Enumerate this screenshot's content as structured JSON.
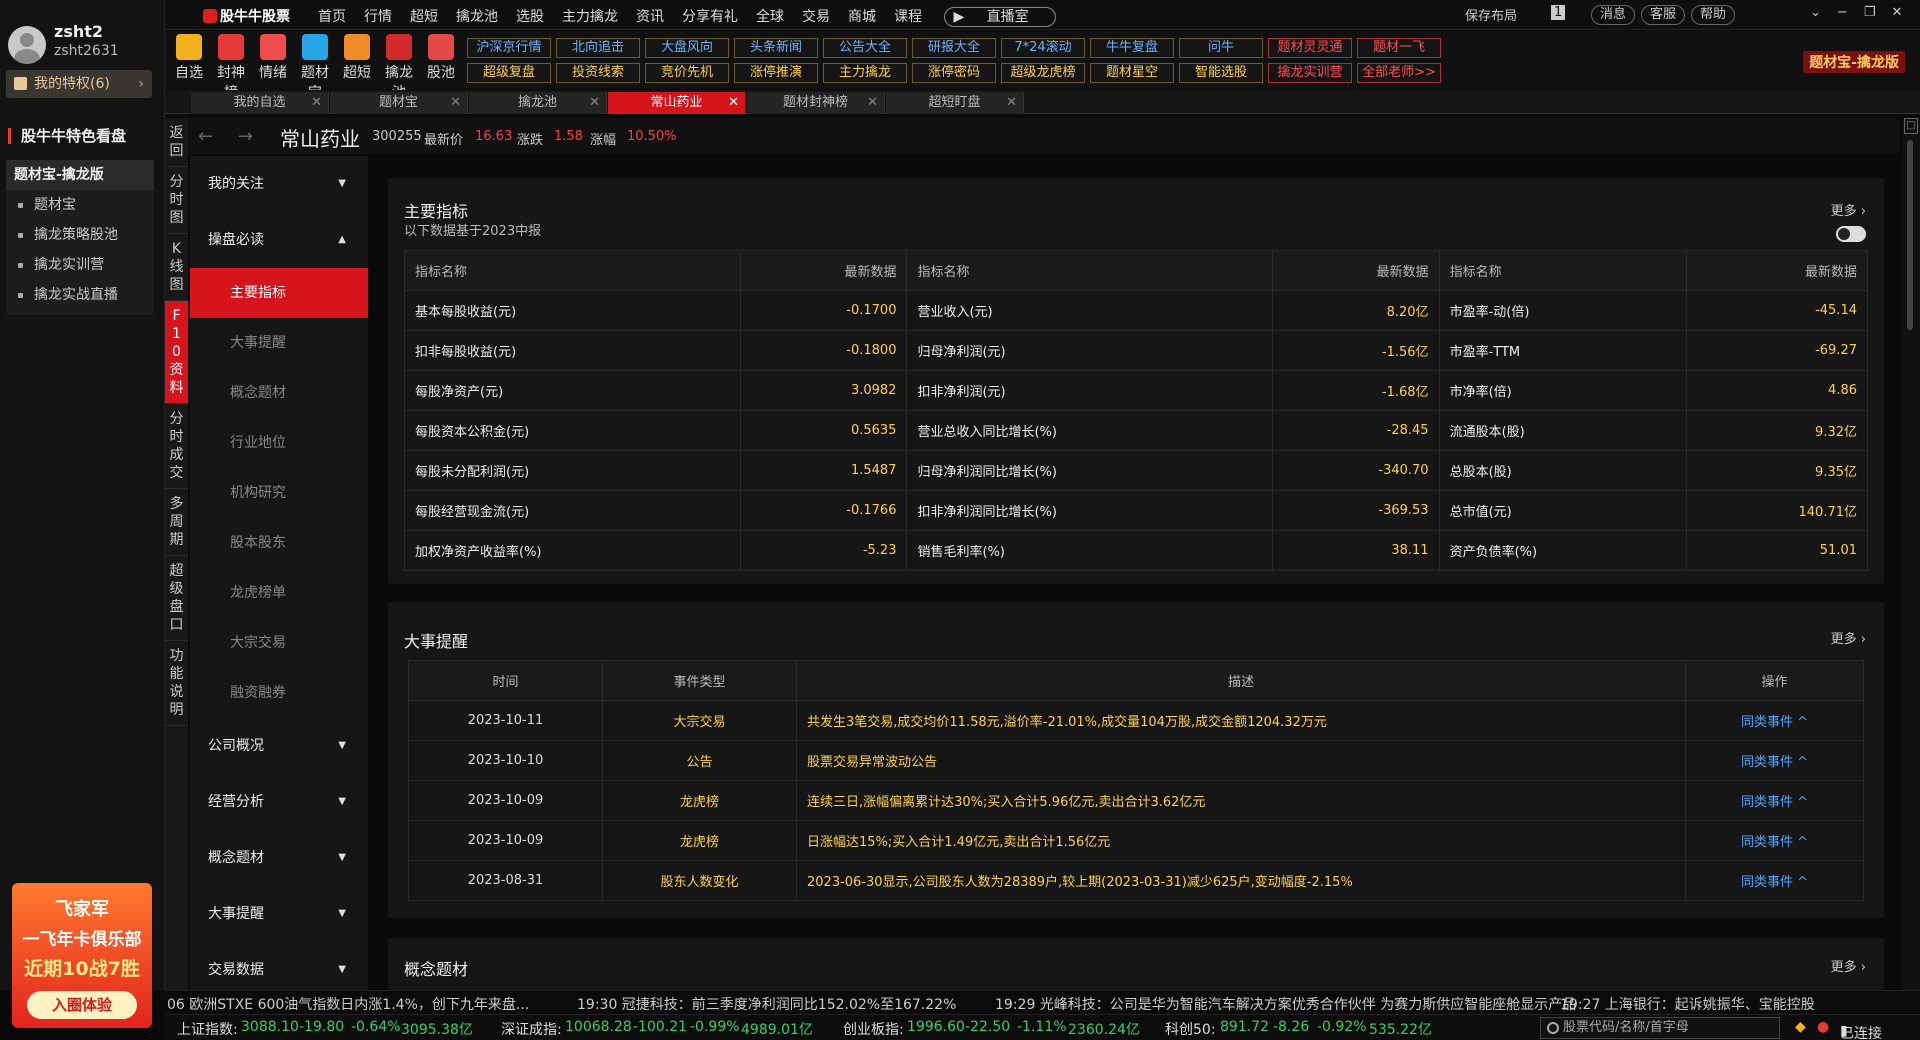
{
  "user": {
    "name": "zsht2",
    "id": "zsht2631",
    "privilege": "我的特权(6)"
  },
  "sidebar": {
    "feature_title": "股牛牛特色看盘",
    "group": "题材宝-擒龙版",
    "items": [
      "题材宝",
      "擒龙策略股池",
      "擒龙实训营",
      "擒龙实战直播"
    ]
  },
  "ad": {
    "l1": "飞家军",
    "l2": "一飞年卡俱乐部",
    "l3": "近期10战7胜",
    "btn": "入圈体验"
  },
  "vnav": [
    "返回",
    "分时图",
    "K线图",
    "F10资料",
    "分时成交",
    "多周期",
    "超级盘口",
    "功能说明"
  ],
  "topbar": {
    "logo": "股牛牛股票",
    "menu": [
      "首页",
      "行情",
      "超短",
      "擒龙池",
      "选股",
      "主力擒龙",
      "资讯",
      "分享有礼",
      "全球",
      "交易",
      "商城",
      "课程"
    ],
    "live": "直播室",
    "save_layout": "保存布局",
    "layout_num": "1",
    "msg": "消息",
    "service": "客服",
    "help": "帮助"
  },
  "toolbar": {
    "icons": [
      {
        "label": "自选",
        "color": "#f2b21d"
      },
      {
        "label": "封神榜",
        "color": "#e63a3a"
      },
      {
        "label": "情绪",
        "color": "#f04d4d"
      },
      {
        "label": "题材宝",
        "color": "#27a6e5"
      },
      {
        "label": "超短",
        "color": "#f08c2a"
      },
      {
        "label": "擒龙池",
        "color": "#d12a2a"
      },
      {
        "label": "股池",
        "color": "#e54848"
      }
    ],
    "row1": [
      "沪深京行情",
      "北向追击",
      "大盘风向",
      "头条新闻",
      "公告大全",
      "研报大全",
      "7*24滚动",
      "牛牛复盘",
      "问牛",
      "题材灵灵通",
      "题材一飞"
    ],
    "row2": [
      "超级复盘",
      "投资线索",
      "竞价先机",
      "涨停推演",
      "主力擒龙",
      "涨停密码",
      "超级龙虎榜",
      "题材星空",
      "智能选股",
      "擒龙实训营",
      "全部老师>>"
    ],
    "brand": "题材宝-擒龙版"
  },
  "tabs": [
    "我的自选",
    "题材宝",
    "擒龙池",
    "常山药业",
    "题材封神榜",
    "超短盯盘"
  ],
  "stock": {
    "name": "常山药业",
    "code": "300255",
    "price_label": "最新价",
    "price": "16.63",
    "change_label": "涨跌",
    "change": "1.58",
    "pct_label": "涨幅",
    "pct": "10.50%"
  },
  "submenu": {
    "groups": [
      "我的关注",
      "操盘必读"
    ],
    "items": [
      "主要指标",
      "大事提醒",
      "概念题材",
      "行业地位",
      "机构研究",
      "股本股东",
      "龙虎榜单",
      "大宗交易",
      "融资融券"
    ],
    "groups2": [
      "公司概况",
      "经营分析",
      "概念题材",
      "大事提醒",
      "交易数据"
    ]
  },
  "key": {
    "title": "主要指标",
    "sub": "以下数据基于2023中报",
    "more": "更多",
    "headers": [
      "指标名称",
      "最新数据"
    ],
    "rows": [
      [
        "基本每股收益(元)",
        "-0.1700",
        "营业收入(元)",
        "8.20亿",
        "市盈率-动(倍)",
        "-45.14"
      ],
      [
        "扣非每股收益(元)",
        "-0.1800",
        "归母净利润(元)",
        "-1.56亿",
        "市盈率-TTM",
        "-69.27"
      ],
      [
        "每股净资产(元)",
        "3.0982",
        "扣非净利润(元)",
        "-1.68亿",
        "市净率(倍)",
        "4.86"
      ],
      [
        "每股资本公积金(元)",
        "0.5635",
        "营业总收入同比增长(%)",
        "-28.45",
        "流通股本(股)",
        "9.32亿"
      ],
      [
        "每股未分配利润(元)",
        "1.5487",
        "归母净利润同比增长(%)",
        "-340.70",
        "总股本(股)",
        "9.35亿"
      ],
      [
        "每股经营现金流(元)",
        "-0.1766",
        "扣非净利润同比增长(%)",
        "-369.53",
        "总市值(元)",
        "140.71亿"
      ],
      [
        "加权净资产收益率(%)",
        "-5.23",
        "销售毛利率(%)",
        "38.11",
        "资产负债率(%)",
        "51.01"
      ]
    ]
  },
  "events": {
    "title": "大事提醒",
    "more": "更多",
    "headers": [
      "时间",
      "事件类型",
      "描述",
      "操作"
    ],
    "rows": [
      [
        "2023-10-11",
        "大宗交易",
        "共发生3笔交易,成交均价11.58元,溢价率-21.01%,成交量104万股,成交金额1204.32万元",
        "同类事件"
      ],
      [
        "2023-10-10",
        "公告",
        "股票交易异常波动公告",
        "同类事件"
      ],
      [
        "2023-10-09",
        "龙虎榜",
        "连续三日,涨幅偏离累计达30%;买入合计5.96亿元,卖出合计3.62亿元",
        "同类事件"
      ],
      [
        "2023-10-09",
        "龙虎榜",
        "日涨幅达15%;买入合计1.49亿元,卖出合计1.56亿元",
        "同类事件"
      ],
      [
        "2023-08-31",
        "股东人数变化",
        "2023-06-30显示,公司股东人数为28389户,较上期(2023-03-31)减少625户,变动幅度-2.15%",
        "同类事件"
      ]
    ]
  },
  "concept": {
    "title": "概念题材",
    "more": "更多"
  },
  "ticker": [
    "06 欧洲STXE 600油气指数日内涨1.4%，创下九年来盘...",
    "19:30 冠捷科技：前三季度净利润同比152.02%至167.22%",
    "19:29 光峰科技：公司是华为智能汽车解决方案优秀合作伙伴 为赛力斯供应智能座舱显示产品",
    "19:27 上海银行：起诉姚振华、宝能控股"
  ],
  "status": {
    "sh": {
      "name": "上证指数:",
      "v": "3088.10",
      "c": "-19.80",
      "p": "-0.64%",
      "a": "3095.38亿"
    },
    "sz": {
      "name": "深证成指:",
      "v": "10068.28",
      "c": "-100.21",
      "p": "-0.99%",
      "a": "4989.01亿"
    },
    "cy": {
      "name": "创业板指:",
      "v": "1996.60",
      "c": "-22.50",
      "p": "-1.11%",
      "a": "2360.24亿"
    },
    "kc": {
      "name": "科创50:",
      "v": "891.72",
      "c": "-8.26",
      "p": "-0.92%",
      "a": "535.22亿"
    },
    "search_placeholder": "股票代码/名称/首字母",
    "connected": "已连接"
  }
}
